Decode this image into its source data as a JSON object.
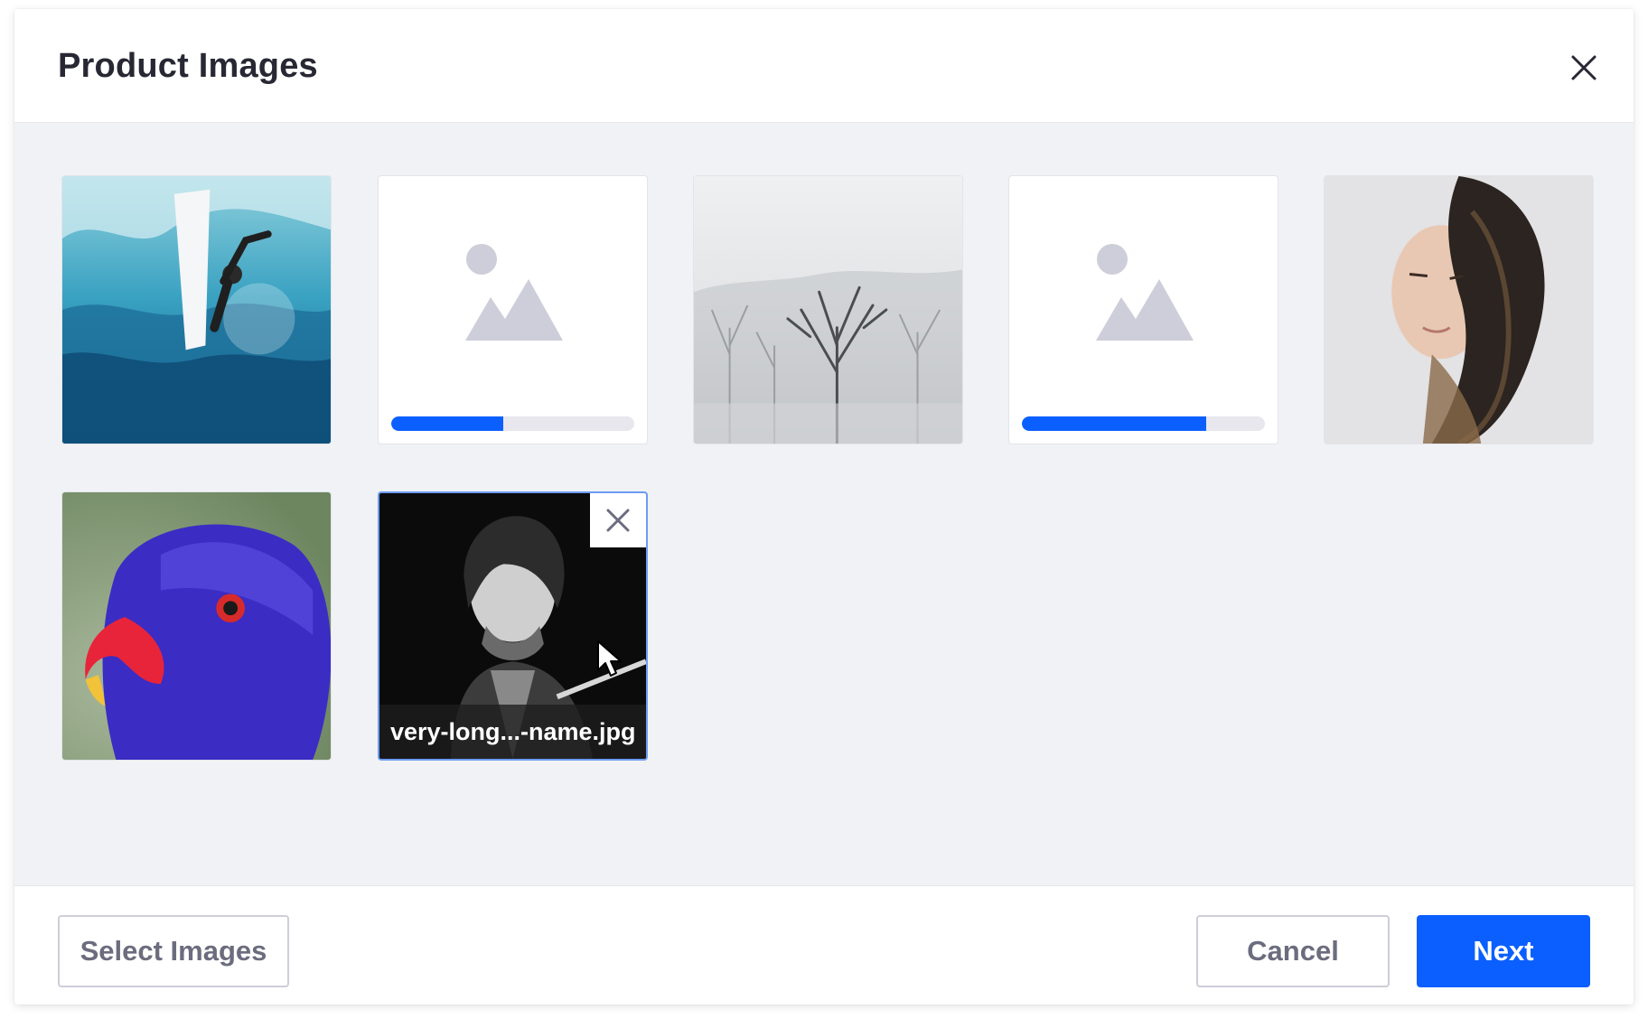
{
  "modal": {
    "title": "Product Images"
  },
  "cards": [
    {
      "kind": "image",
      "subject": "surfer on a wave"
    },
    {
      "kind": "uploading",
      "progress": 0.46
    },
    {
      "kind": "image",
      "subject": "snowy forest trees"
    },
    {
      "kind": "uploading",
      "progress": 0.76
    },
    {
      "kind": "image",
      "subject": "woman with windblown hair"
    },
    {
      "kind": "image",
      "subject": "blue parrot"
    },
    {
      "kind": "image",
      "subject": "man playing guitar",
      "selected": true,
      "caption": "very-long...-name.jpg"
    }
  ],
  "footer": {
    "select_label": "Select Images",
    "cancel_label": "Cancel",
    "next_label": "Next"
  },
  "colors": {
    "primary": "#0b5fff",
    "body_bg": "#f0f2f5",
    "placeholder_icon": "#cdced9",
    "selected_border": "#6c9cf4"
  }
}
